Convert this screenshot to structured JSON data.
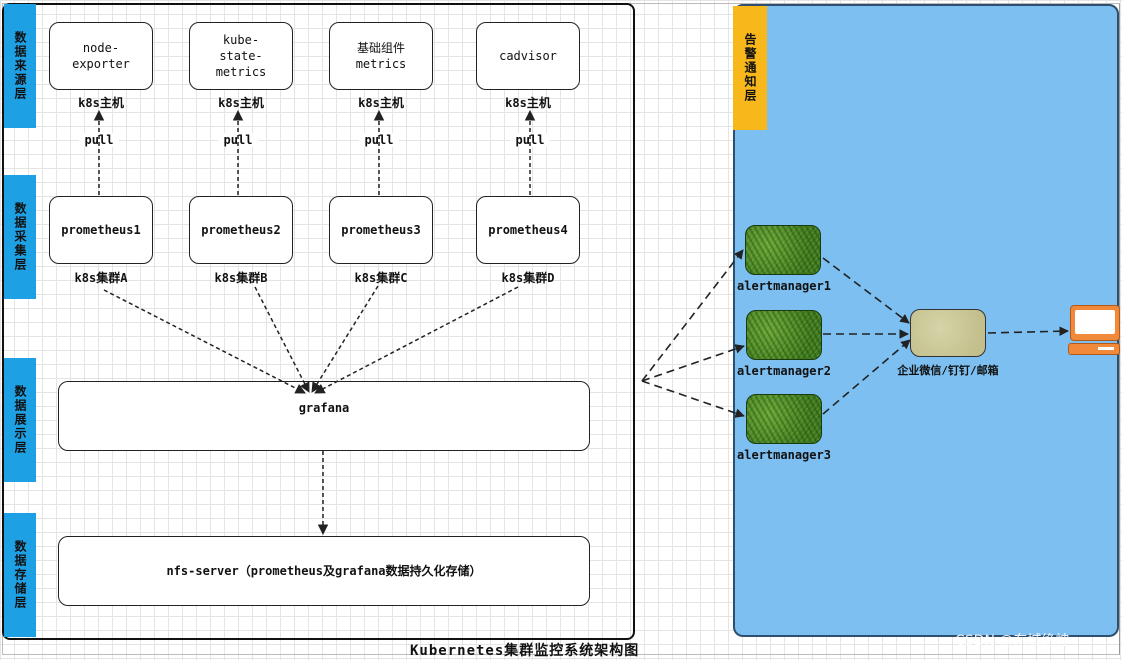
{
  "layers": {
    "source": "数据来源层",
    "collect": "数据采集层",
    "display": "数据展示层",
    "storage": "数据存储层",
    "alert": "告警通知层"
  },
  "sources": [
    {
      "name": "node-\nexporter",
      "host": "k8s主机"
    },
    {
      "name": "kube-\nstate-\nmetrics",
      "host": "k8s主机"
    },
    {
      "name": "基础组件\nmetrics",
      "host": "k8s主机"
    },
    {
      "name": "cadvisor",
      "host": "k8s主机"
    }
  ],
  "pull_label": "pull",
  "prometheus": [
    {
      "name": "prometheus1",
      "cluster": "k8s集群A"
    },
    {
      "name": "prometheus2",
      "cluster": "k8s集群B"
    },
    {
      "name": "prometheus3",
      "cluster": "k8s集群C"
    },
    {
      "name": "prometheus4",
      "cluster": "k8s集群D"
    }
  ],
  "grafana": "grafana",
  "nfs": "nfs-server（prometheus及grafana数据持久化存储）",
  "alertmanagers": [
    "alertmanager1",
    "alertmanager2",
    "alertmanager3"
  ],
  "notify": "企业微信/钉钉/邮箱",
  "title": "Kubernetes集群监控系统架构图",
  "watermark": "CSDN @东城绝神",
  "colors": {
    "layer": "#1ea1e4",
    "alert_layer": "#f8b81c",
    "alert_panel": "#7cbff0",
    "terminal": "#f08a3a"
  }
}
